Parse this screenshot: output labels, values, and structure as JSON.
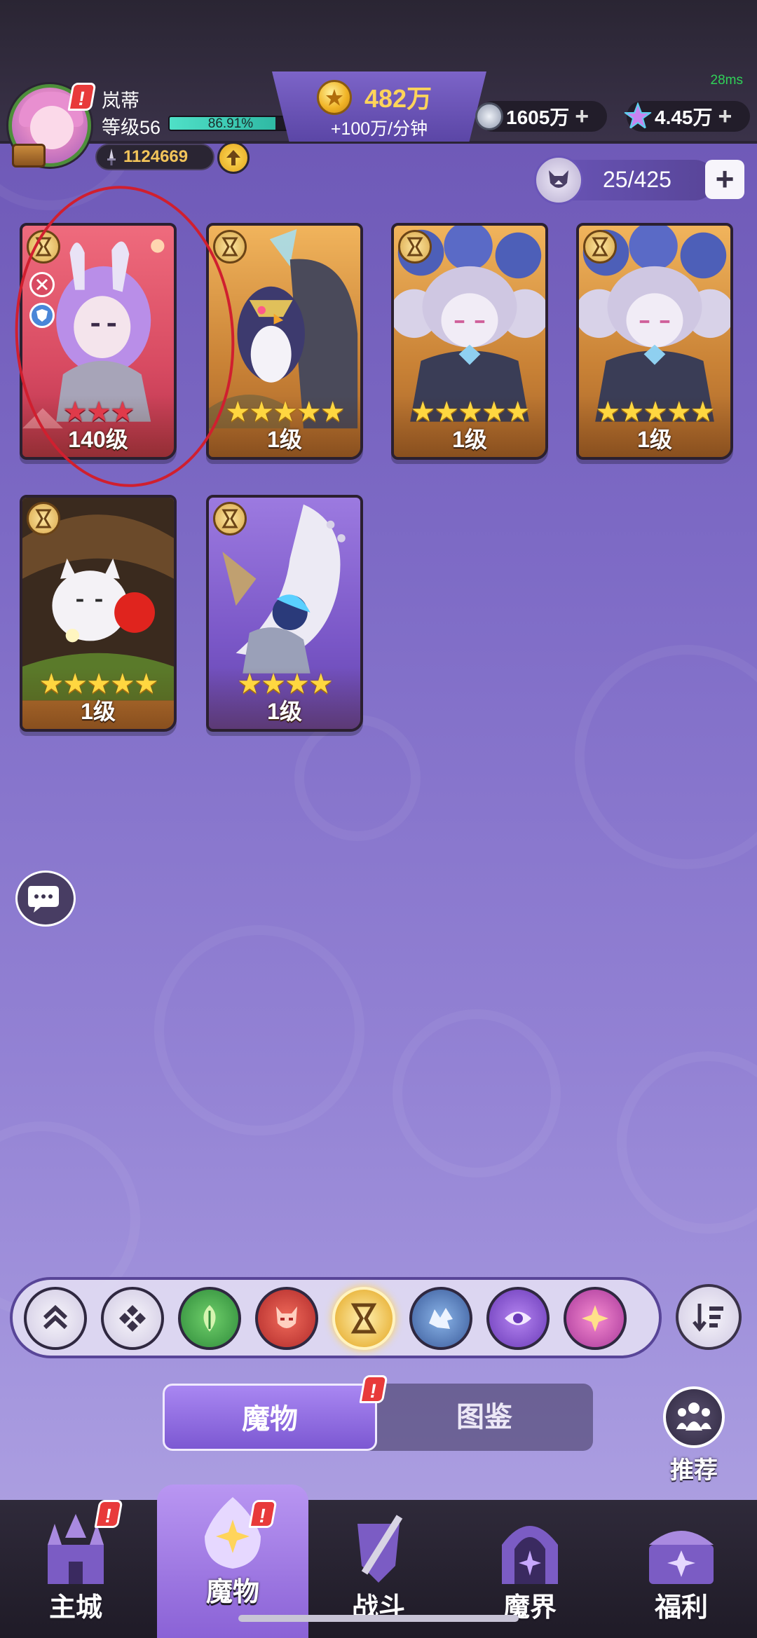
{
  "status": {
    "ping": "28ms"
  },
  "player": {
    "name": "岚蒂",
    "level": "等级56",
    "exp_percent": "86.91%",
    "exp_fraction": 0.8691,
    "power": "1124669"
  },
  "currency": {
    "gold": "482万",
    "gold_rate": "+100万/分钟",
    "silver": "1605万",
    "gems": "4.45万"
  },
  "capacity": {
    "value": "25/425"
  },
  "cards": [
    {
      "level": "140级",
      "stars": 3,
      "star_color": "red",
      "frame": "red"
    },
    {
      "level": "1级",
      "stars": 5,
      "star_color": "gold",
      "frame": "gold"
    },
    {
      "level": "1级",
      "stars": 5,
      "star_color": "gold",
      "frame": "gold"
    },
    {
      "level": "1级",
      "stars": 5,
      "star_color": "gold",
      "frame": "gold"
    },
    {
      "level": "1级",
      "stars": 5,
      "star_color": "gold",
      "frame": "gold"
    },
    {
      "level": "1级",
      "stars": 4,
      "star_color": "gold",
      "frame": "purple"
    }
  ],
  "filters": [
    {
      "name": "sort-up-icon"
    },
    {
      "name": "all-factions-icon"
    },
    {
      "name": "nature-faction-icon"
    },
    {
      "name": "demon-faction-icon"
    },
    {
      "name": "hourglass-faction-icon"
    },
    {
      "name": "dragon-faction-icon"
    },
    {
      "name": "eye-faction-icon"
    },
    {
      "name": "star-faction-icon"
    }
  ],
  "tabs": {
    "monsters": "魔物",
    "codex": "图鉴"
  },
  "recommend": {
    "label": "推荐"
  },
  "nav": {
    "main_city": "主城",
    "monsters": "魔物",
    "battle": "战斗",
    "demon_realm": "魔界",
    "benefits": "福利"
  },
  "colors": {
    "accent": "#7c58d2",
    "gold_text": "#ffd45a",
    "exp_bar": "#4fe0c7",
    "alert": "#e83a3a"
  }
}
